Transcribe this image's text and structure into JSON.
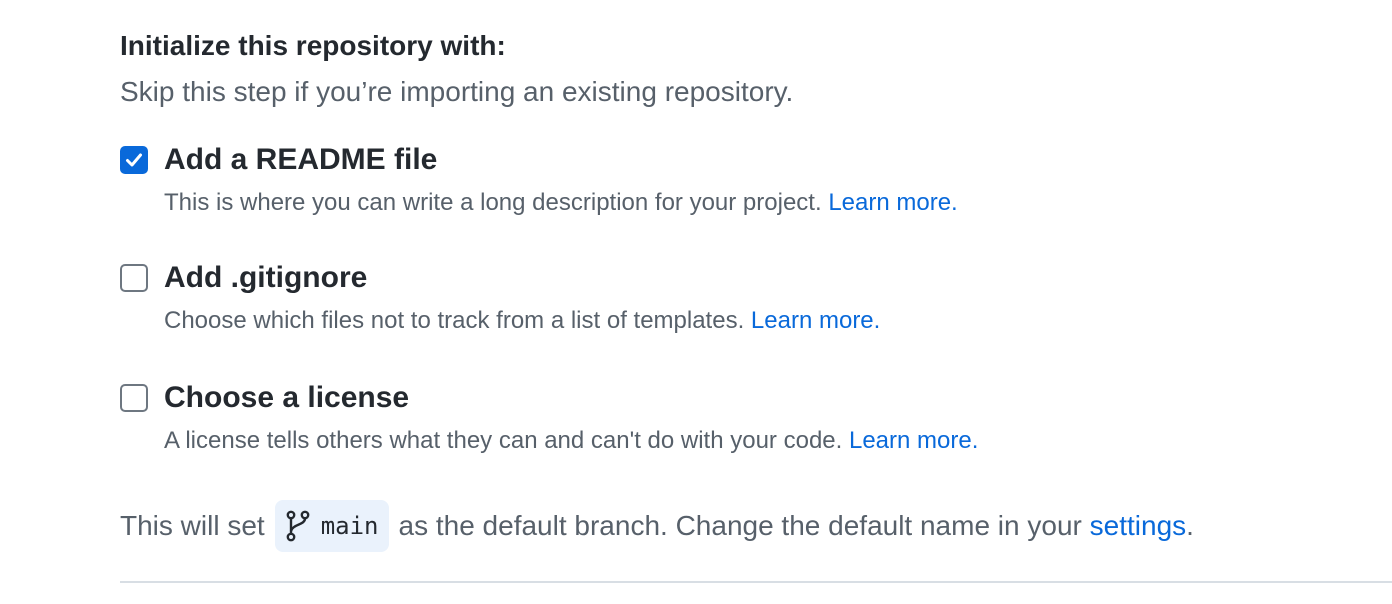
{
  "section": {
    "heading": "Initialize this repository with:",
    "subheading": "Skip this step if you’re importing an existing repository."
  },
  "options": [
    {
      "title": "Add a README file",
      "description": "This is where you can write a long description for your project. ",
      "link_text": "Learn more.",
      "checked": true
    },
    {
      "title": "Add .gitignore",
      "description": "Choose which files not to track from a list of templates. ",
      "link_text": "Learn more.",
      "checked": false
    },
    {
      "title": "Choose a license",
      "description": "A license tells others what they can and can't do with your code. ",
      "link_text": "Learn more.",
      "checked": false
    }
  ],
  "branch": {
    "prefix": "This will set",
    "name": "main",
    "middle": "as the default branch. Change the default name in your",
    "settings_link": "settings",
    "suffix": "."
  },
  "colors": {
    "accent": "#0969da",
    "text_primary": "#24292f",
    "text_muted": "#57606a",
    "branch_pill_bg": "#eaf2fc",
    "divider": "#d8dee4"
  },
  "icons": {
    "checked": "checkmark-icon",
    "branch": "git-branch-icon"
  }
}
